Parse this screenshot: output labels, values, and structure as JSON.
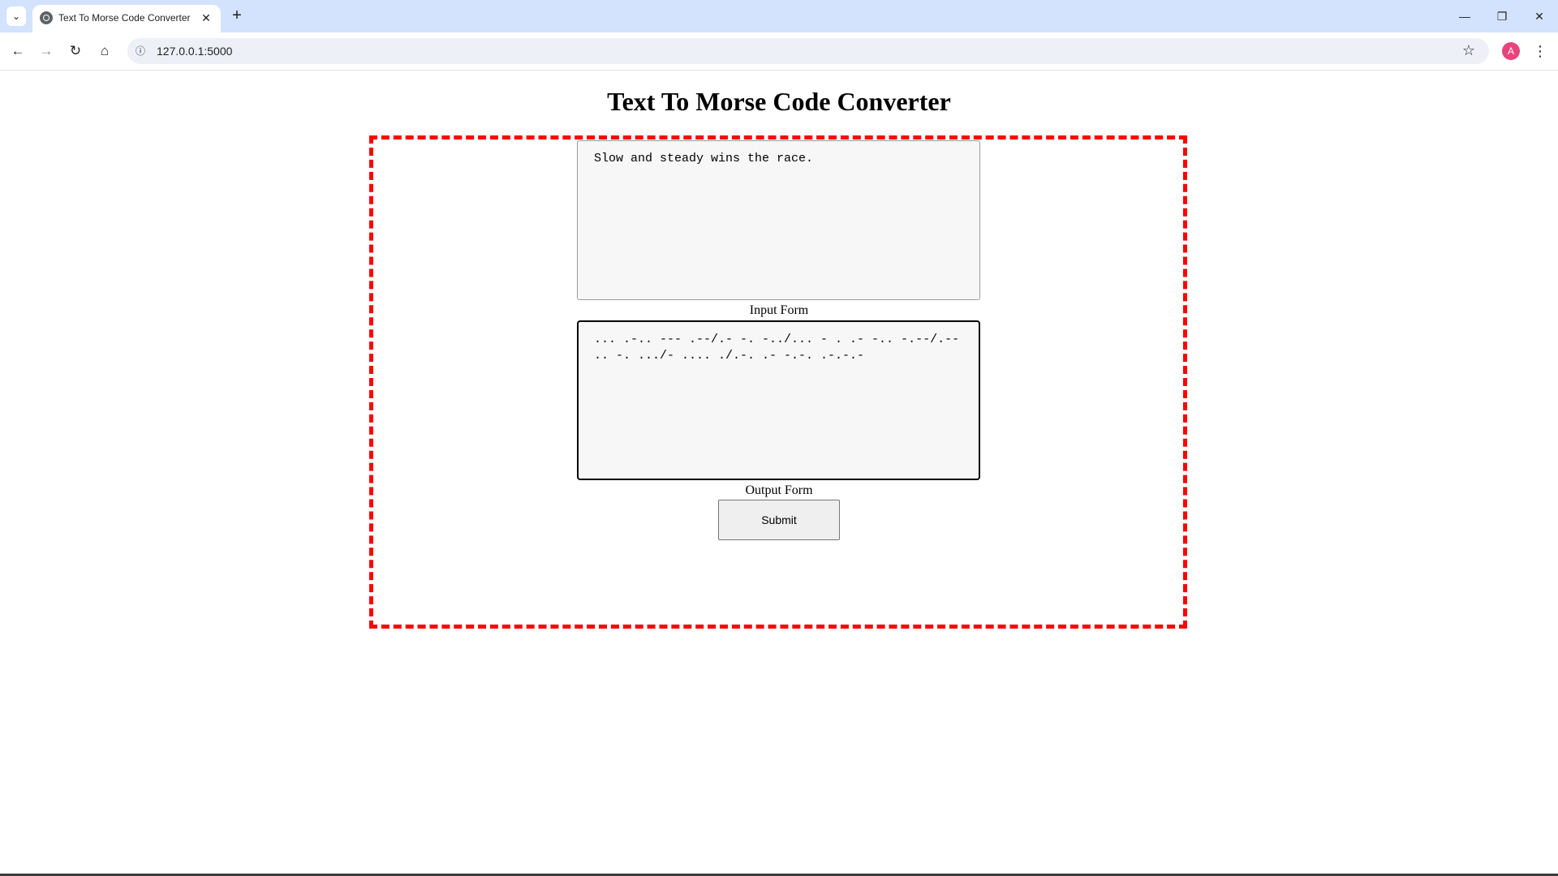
{
  "browser": {
    "tab_title": "Text To Morse Code Converter",
    "url": "127.0.0.1:5000",
    "profile_initial": "A",
    "icons": {
      "tab_search": "chevron-down-icon",
      "favicon": "globe-icon",
      "tab_close": "close-icon",
      "new_tab": "plus-icon",
      "back": "arrow-left-icon",
      "forward": "arrow-right-icon",
      "reload": "reload-icon",
      "home": "home-icon",
      "site_info": "info-icon",
      "bookmark": "star-icon",
      "menu": "more-vertical-icon",
      "minimize": "minimize-icon",
      "restore": "restore-icon",
      "close_window": "close-icon"
    },
    "colors": {
      "tabstrip": "#d3e3fd",
      "omnibox": "#edf0f7",
      "avatar": "#e8437a"
    }
  },
  "page": {
    "title": "Text To Morse Code Converter",
    "input_text": "Slow and steady wins the race.",
    "input_label": "Input Form",
    "output_text": "... .-.. --- .--/.- -. -../... - . .- -.. -.--/.-- .. -. .../- .... ./.-. .- -.-. .-.-.-",
    "output_label": "Output Form",
    "submit_label": "Submit",
    "colors": {
      "frame_border": "#ff0000"
    }
  }
}
